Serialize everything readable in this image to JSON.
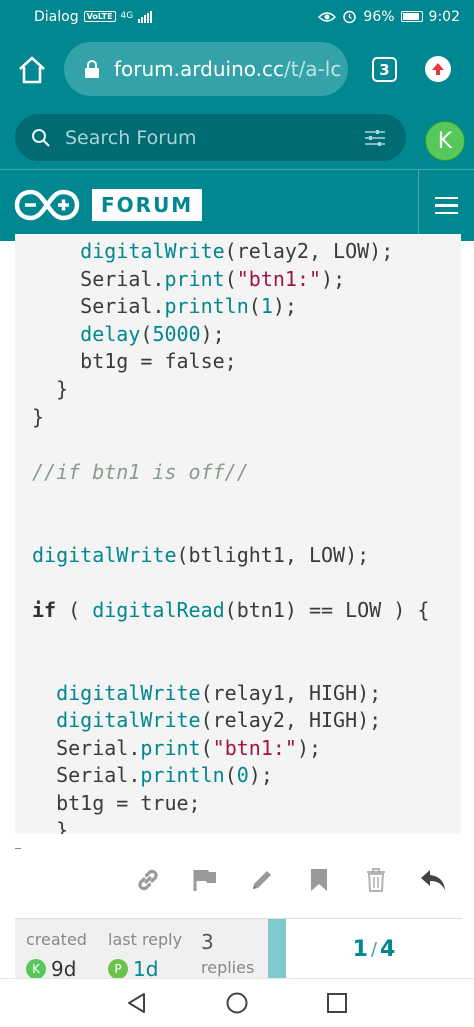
{
  "status_bar": {
    "carrier": "Dialog",
    "volte": "VoLTE",
    "network": "4G",
    "battery": "96%",
    "time": "9:02"
  },
  "browser": {
    "url_domain": "forum.arduino.cc",
    "url_path": "/t/a-lc",
    "tab_count": "3"
  },
  "forum": {
    "search_placeholder": "Search Forum",
    "user_initial": "K",
    "logo_text": "FORUM"
  },
  "code_lines": [
    {
      "indent": "    ",
      "tokens": [
        {
          "t": "fn",
          "v": "digitalWrite"
        },
        {
          "t": "p",
          "v": "(relay2, LOW);"
        }
      ]
    },
    {
      "indent": "    ",
      "tokens": [
        {
          "t": "p",
          "v": "Serial."
        },
        {
          "t": "fn",
          "v": "print"
        },
        {
          "t": "p",
          "v": "("
        },
        {
          "t": "str",
          "v": "\"btn1:\""
        },
        {
          "t": "p",
          "v": ");"
        }
      ]
    },
    {
      "indent": "    ",
      "tokens": [
        {
          "t": "p",
          "v": "Serial."
        },
        {
          "t": "fn",
          "v": "println"
        },
        {
          "t": "p",
          "v": "("
        },
        {
          "t": "num",
          "v": "1"
        },
        {
          "t": "p",
          "v": ");"
        }
      ]
    },
    {
      "indent": "    ",
      "tokens": [
        {
          "t": "fn",
          "v": "delay"
        },
        {
          "t": "p",
          "v": "("
        },
        {
          "t": "num",
          "v": "5000"
        },
        {
          "t": "p",
          "v": ");"
        }
      ]
    },
    {
      "indent": "    ",
      "tokens": [
        {
          "t": "p",
          "v": "bt1g = false;"
        }
      ]
    },
    {
      "indent": "  ",
      "tokens": [
        {
          "t": "p",
          "v": "}"
        }
      ]
    },
    {
      "indent": "",
      "tokens": [
        {
          "t": "p",
          "v": "}"
        }
      ]
    },
    {
      "indent": "",
      "tokens": []
    },
    {
      "indent": "",
      "tokens": [
        {
          "t": "cm",
          "v": "//if btn1 is off//"
        }
      ]
    },
    {
      "indent": "",
      "tokens": []
    },
    {
      "indent": "",
      "tokens": []
    },
    {
      "indent": "",
      "tokens": [
        {
          "t": "fn",
          "v": "digitalWrite"
        },
        {
          "t": "p",
          "v": "(btlight1, LOW);"
        }
      ]
    },
    {
      "indent": "",
      "tokens": []
    },
    {
      "indent": "",
      "tokens": [
        {
          "t": "kw",
          "v": "if"
        },
        {
          "t": "p",
          "v": " ( "
        },
        {
          "t": "fn",
          "v": "digitalRead"
        },
        {
          "t": "p",
          "v": "(btn1) == LOW ) {"
        }
      ]
    },
    {
      "indent": "",
      "tokens": []
    },
    {
      "indent": "",
      "tokens": []
    },
    {
      "indent": "  ",
      "tokens": [
        {
          "t": "fn",
          "v": "digitalWrite"
        },
        {
          "t": "p",
          "v": "(relay1, HIGH);"
        }
      ]
    },
    {
      "indent": "  ",
      "tokens": [
        {
          "t": "fn",
          "v": "digitalWrite"
        },
        {
          "t": "p",
          "v": "(relay2, HIGH);"
        }
      ]
    },
    {
      "indent": "  ",
      "tokens": [
        {
          "t": "p",
          "v": "Serial."
        },
        {
          "t": "fn",
          "v": "print"
        },
        {
          "t": "p",
          "v": "("
        },
        {
          "t": "str",
          "v": "\"btn1:\""
        },
        {
          "t": "p",
          "v": ");"
        }
      ]
    },
    {
      "indent": "  ",
      "tokens": [
        {
          "t": "p",
          "v": "Serial."
        },
        {
          "t": "fn",
          "v": "println"
        },
        {
          "t": "p",
          "v": "("
        },
        {
          "t": "num",
          "v": "0"
        },
        {
          "t": "p",
          "v": ");"
        }
      ]
    },
    {
      "indent": "  ",
      "tokens": [
        {
          "t": "p",
          "v": "bt1g = true;"
        }
      ]
    },
    {
      "indent": "  ",
      "tokens": [
        {
          "t": "p",
          "v": "}"
        }
      ]
    }
  ],
  "post_actions": [
    "link-icon",
    "flag-icon",
    "pencil-icon",
    "bookmark-icon",
    "trash-icon",
    "reply-icon"
  ],
  "topic_summary": {
    "created_label": "created",
    "created_initial": "K",
    "created_value": "9d",
    "last_reply_label": "last reply",
    "last_reply_initial": "P",
    "last_reply_value": "1d",
    "replies_count": "3",
    "replies_label": "replies",
    "position_current": "1",
    "position_separator": "/",
    "position_total": "4",
    "progress_fraction": 0.25
  },
  "colors": {
    "brand": "#00878f",
    "avatar_green": "#56c95a",
    "avatar_p": "#6cc24a"
  }
}
